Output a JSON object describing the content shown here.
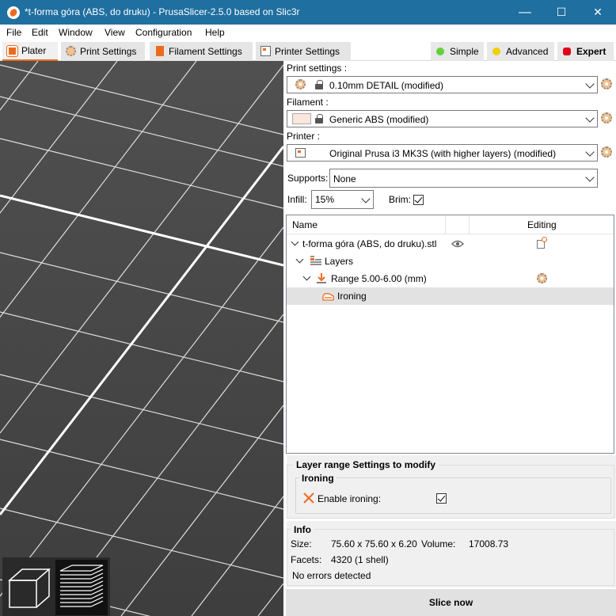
{
  "window": {
    "title": "*t-forma góra (ABS, do druku) - PrusaSlicer-2.5.0 based on Slic3r",
    "minimize_glyph": "—",
    "maximize_glyph": "☐",
    "close_glyph": "✕"
  },
  "menu": [
    "File",
    "Edit",
    "Window",
    "View",
    "Configuration",
    "Help"
  ],
  "tabs": [
    {
      "label": "Plater",
      "icon": "plater-icon"
    },
    {
      "label": "Print Settings",
      "icon": "print-settings-icon"
    },
    {
      "label": "Filament Settings",
      "icon": "filament-icon"
    },
    {
      "label": "Printer Settings",
      "icon": "printer-icon"
    }
  ],
  "modes": [
    {
      "label": "Simple",
      "color": "#5fd23a"
    },
    {
      "label": "Advanced",
      "color": "#f0d000"
    },
    {
      "label": "Expert",
      "color": "#e0001b"
    }
  ],
  "presets": {
    "print_label": "Print settings :",
    "print_value": "0.10mm DETAIL (modified)",
    "filament_label": "Filament :",
    "filament_value": "Generic ABS (modified)",
    "filament_color": "#f9e6dc",
    "printer_label": "Printer :",
    "printer_value": "Original Prusa i3 MK3S (with higher layers) (modified)",
    "supports_label": "Supports:",
    "supports_value": "None",
    "infill_label": "Infill:",
    "infill_value": "15%",
    "brim_label": "Brim:",
    "brim_checked": true
  },
  "object_list": {
    "col_name": "Name",
    "col_editing": "Editing",
    "rows": [
      {
        "label": "t-forma góra (ABS, do druku).stl",
        "level": 0
      },
      {
        "label": "Layers",
        "level": 1
      },
      {
        "label": "Range 5.00-6.00 (mm)",
        "level": 2
      },
      {
        "label": "Ironing",
        "level": 3,
        "selected": true
      }
    ]
  },
  "layer_settings": {
    "title": "Layer range Settings to modify",
    "group": "Ironing",
    "enable_label": "Enable ironing:",
    "enable_checked": true
  },
  "info": {
    "title": "Info",
    "size_label": "Size:",
    "size_value": "75.60 x 75.60 x 6.20",
    "volume_label": "Volume:",
    "volume_value": "17008.73",
    "facets_label": "Facets:",
    "facets_value": "4320 (1 shell)",
    "errors": "No errors detected"
  },
  "slice_button": "Slice now",
  "accent_color": "#ed6b21"
}
